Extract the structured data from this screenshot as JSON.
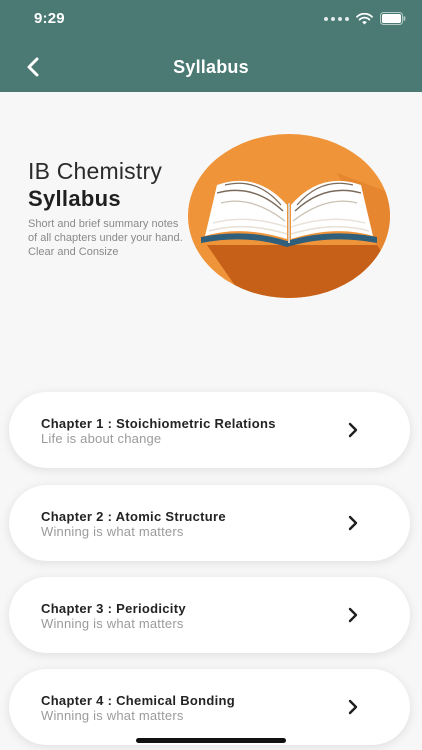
{
  "status": {
    "time": "9:29"
  },
  "header": {
    "title": "Syllabus"
  },
  "hero": {
    "title_line1": "IB Chemistry",
    "title_line2": "Syllabus",
    "description": "Short and brief summary notes of all chapters under your hand. Clear and Consize",
    "image_icon": "open-book-icon"
  },
  "chapters": [
    {
      "title": "Chapter 1 : Stoichiometric Relations",
      "subtitle": "Life is about change"
    },
    {
      "title": "Chapter 2 : Atomic Structure",
      "subtitle": "Winning is what matters"
    },
    {
      "title": "Chapter 3 : Periodicity",
      "subtitle": "Winning is what matters"
    },
    {
      "title": "Chapter 4 : Chemical Bonding",
      "subtitle": "Winning is what matters"
    }
  ],
  "colors": {
    "header_bg": "#4a7a73",
    "accent_orange": "#f0943a",
    "background": "#f7f7f7"
  }
}
